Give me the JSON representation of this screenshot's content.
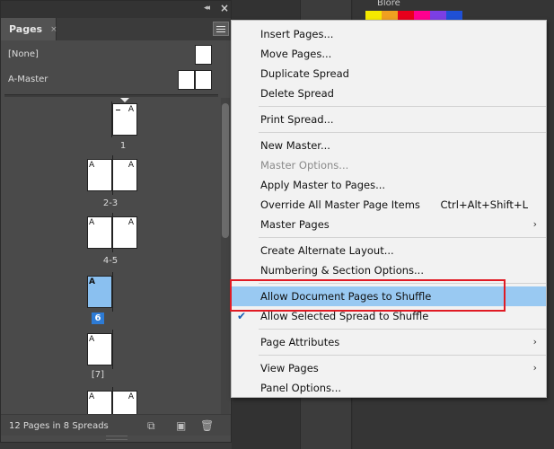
{
  "background_panel": {
    "title": "Blore",
    "swatches": [
      "#f5e900",
      "#f0a020",
      "#e8001c",
      "#ff0090",
      "#7b3fe4",
      "#1f50d6"
    ]
  },
  "pages_panel": {
    "tab_label": "Pages",
    "tab_close": "×",
    "collapse_glyph": "◂◂",
    "close_glyph": "×",
    "masters": [
      {
        "label": "[None]"
      },
      {
        "label": "A-Master"
      }
    ],
    "pages": [
      {
        "label": "1",
        "left_marker": "",
        "right_marker": "A"
      },
      {
        "label": "2-3",
        "left_marker": "A",
        "right_marker": "A"
      },
      {
        "label": "4-5",
        "left_marker": "A",
        "right_marker": "A"
      },
      {
        "label": "6",
        "left_marker": "A",
        "right_marker": ""
      },
      {
        "label": "[7]",
        "left_marker": "A",
        "right_marker": ""
      },
      {
        "label": "",
        "left_marker": "A",
        "right_marker": "A"
      }
    ],
    "footer_text": "12 Pages in 8 Spreads",
    "footer_icons": [
      "new-page-size-icon",
      "new-page-icon",
      "trash-icon"
    ]
  },
  "menu": {
    "items": [
      {
        "label": "Insert Pages...",
        "enabled": true
      },
      {
        "label": "Move Pages...",
        "enabled": true
      },
      {
        "label": "Duplicate Spread",
        "enabled": true
      },
      {
        "label": "Delete Spread",
        "enabled": true
      },
      {
        "label": "Print Spread...",
        "enabled": true
      },
      {
        "label": "New Master...",
        "enabled": true
      },
      {
        "label": "Master Options...",
        "enabled": false
      },
      {
        "label": "Apply Master to Pages...",
        "enabled": true
      },
      {
        "label": "Override All Master Page Items",
        "enabled": true,
        "shortcut": "Ctrl+Alt+Shift+L"
      },
      {
        "label": "Master Pages",
        "enabled": true,
        "submenu": true
      },
      {
        "label": "Create Alternate Layout...",
        "enabled": true
      },
      {
        "label": "Numbering & Section Options...",
        "enabled": true
      },
      {
        "label": "Allow Document Pages to Shuffle",
        "enabled": true,
        "highlighted": true
      },
      {
        "label": "Allow Selected Spread to Shuffle",
        "enabled": true,
        "checked": true
      },
      {
        "label": "Page Attributes",
        "enabled": true,
        "submenu": true
      },
      {
        "label": "View Pages",
        "enabled": true,
        "submenu": true
      },
      {
        "label": "Panel Options...",
        "enabled": true
      }
    ],
    "accent_highlight": "#99c9f2",
    "annotation_color": "#e01b24"
  }
}
